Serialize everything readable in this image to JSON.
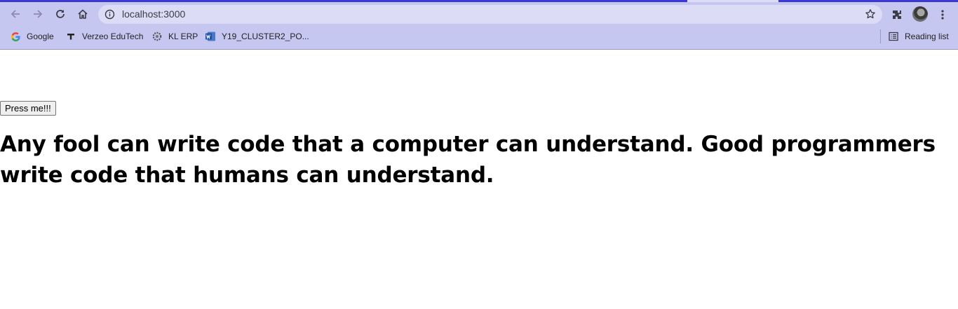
{
  "browser": {
    "url": "localhost:3000",
    "bookmarks": [
      {
        "label": "Google",
        "icon": "google-icon"
      },
      {
        "label": "Verzeo EduTech",
        "icon": "verzeo-icon"
      },
      {
        "label": "KL ERP",
        "icon": "gear-icon"
      },
      {
        "label": "Y19_CLUSTER2_PO...",
        "icon": "word-doc-icon"
      }
    ],
    "reading_list_label": "Reading list",
    "colors": {
      "frame": "#c5c7f1",
      "omnibox": "#dcdcf6",
      "accent_strip": "#3a39d6"
    }
  },
  "page": {
    "button_label": "Press me!!!",
    "heading": "Any fool can write code that a computer can understand. Good programmers write code that humans can understand."
  }
}
